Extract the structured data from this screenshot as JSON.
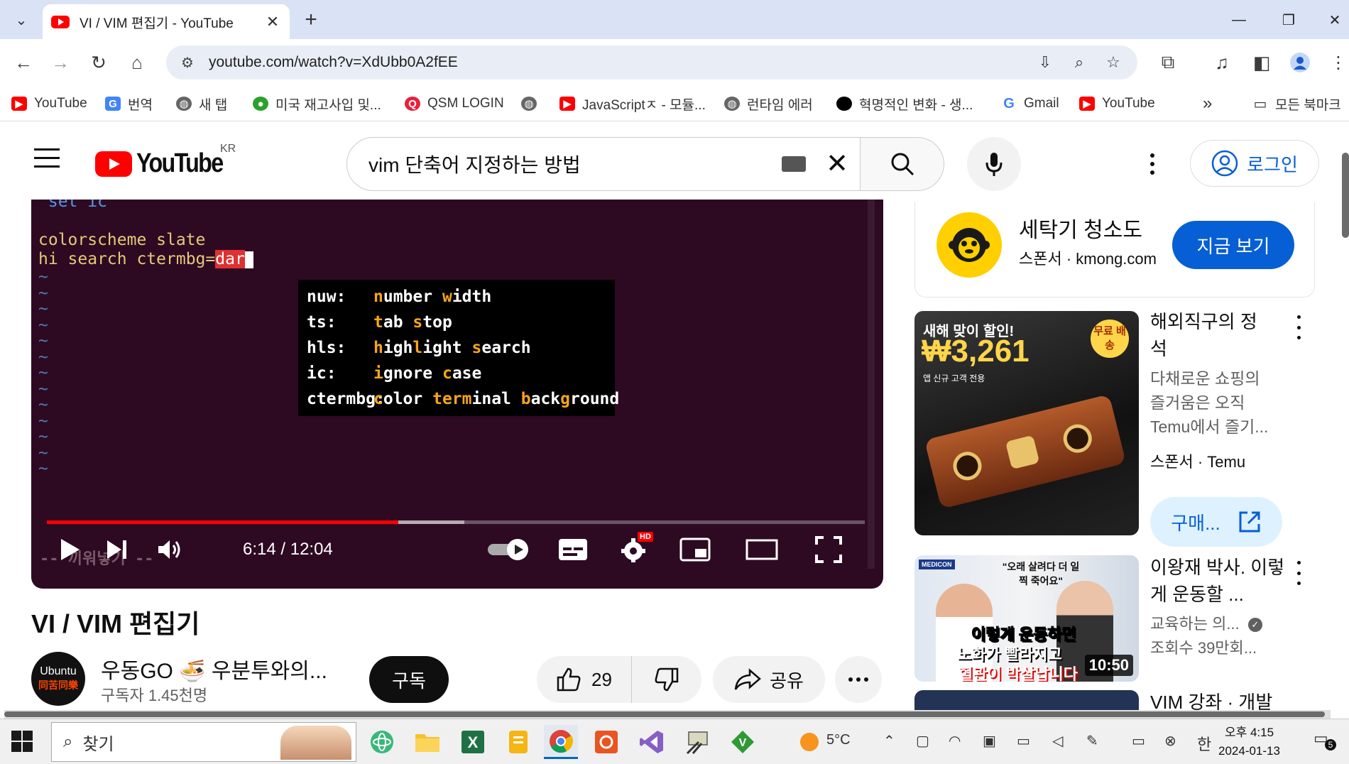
{
  "browser": {
    "tab": {
      "title": "VI / VIM 편집기 - YouTube",
      "close": "✕"
    },
    "new_tab": "+",
    "window_controls": {
      "minimize": "—",
      "maximize": "❐",
      "close": "✕"
    },
    "url": "youtube.com/watch?v=XdUbb0A2fEE",
    "bookmarks": [
      {
        "label": "YouTube",
        "icon": "youtube-icon",
        "color": "#ff0000"
      },
      {
        "label": "번역",
        "icon": "translate-icon",
        "color": "#4285f4"
      },
      {
        "label": "새 탭",
        "icon": "globe-icon",
        "color": "#555555"
      },
      {
        "label": "미국 재고사입 및...",
        "icon": "cup-icon",
        "color": "#2ca02c"
      },
      {
        "label": "QSM LOGIN",
        "icon": "qsm-icon",
        "color": "#e8213a"
      },
      {
        "label": "",
        "icon": "globe-icon",
        "color": "#555555"
      },
      {
        "label": "JavaScriptㅈ - 모듈...",
        "icon": "youtube-icon",
        "color": "#ff0000"
      },
      {
        "label": "런타임 에러",
        "icon": "globe-icon",
        "color": "#555555"
      },
      {
        "label": "혁명적인 변화 - 생...",
        "icon": "dot-icon",
        "color": "#000000"
      },
      {
        "label": "Gmail",
        "icon": "google-icon",
        "color": "#4285f4"
      },
      {
        "label": "YouTube",
        "icon": "youtube-icon",
        "color": "#ff0000"
      }
    ],
    "bookmarks_overflow": "»",
    "all_bookmarks": "모든 북마크"
  },
  "youtube": {
    "logo_text": "YouTube",
    "country": "KR",
    "search_query": "vim 단축어 지정하는 방법",
    "signin_label": "로그인"
  },
  "player": {
    "terminal_lines": [
      "\"set ic",
      "",
      "colorscheme slate",
      "hi search ctermbg="
    ],
    "cursor_text": "dar",
    "popup": [
      {
        "key": "nuw:",
        "parts": [
          [
            "n",
            "h"
          ],
          [
            "umber ",
            ""
          ],
          [
            "w",
            "h"
          ],
          [
            "idth",
            ""
          ]
        ]
      },
      {
        "key": "ts:",
        "parts": [
          [
            "t",
            "h"
          ],
          [
            "ab ",
            ""
          ],
          [
            "s",
            "h"
          ],
          [
            "top",
            ""
          ]
        ]
      },
      {
        "key": "hls:",
        "parts": [
          [
            "h",
            "h"
          ],
          [
            "igh",
            ""
          ],
          [
            "l",
            "h"
          ],
          [
            "ight ",
            ""
          ],
          [
            "s",
            "h"
          ],
          [
            "earch",
            ""
          ]
        ]
      },
      {
        "key": "ic:",
        "parts": [
          [
            "i",
            "h"
          ],
          [
            "gnore ",
            ""
          ],
          [
            "c",
            "h"
          ],
          [
            "ase",
            ""
          ]
        ]
      },
      {
        "key": "ctermbg:",
        "parts": [
          [
            "c",
            "h"
          ],
          [
            "olor ",
            ""
          ],
          [
            "term",
            "h"
          ],
          [
            "inal ",
            ""
          ],
          [
            "b",
            "h"
          ],
          [
            "ack",
            ""
          ],
          [
            "g",
            "h"
          ],
          [
            "round",
            ""
          ]
        ]
      }
    ],
    "time": "6:14 / 12:04",
    "progress_played": 0.43,
    "progress_buffered": 0.51,
    "hd_badge": "HD",
    "bottom_overlay": "-- 끼워넣기 --"
  },
  "video": {
    "title": "VI / VIM 편집기",
    "channel_name": "우동GO 🍜 우분투와의...",
    "channel_avatar_top": "Ubuntu",
    "channel_avatar_bottom": "同苦同樂",
    "subscribers": "구독자 1.45천명",
    "subscribe_label": "구독",
    "likes": "29",
    "share_label": "공유"
  },
  "sidebar": {
    "ad": {
      "title": "세탁기 청소도",
      "sponsor": "스폰서 · kmong.com",
      "cta": "지금 보기"
    },
    "items": [
      {
        "title": "해외직구의 정석",
        "desc": "다채로운 쇼핑의 즐거움은 오직 Temu에서 즐기...",
        "meta": "스폰서 · Temu",
        "thumb_text1": "새해 맞이 할인!",
        "thumb_price": "₩3,261",
        "thumb_text2": "앱 신규 고객 전용",
        "thumb_badge": "무료 배송",
        "buy_label": "구매..."
      },
      {
        "title": "이왕재 박사. 이렇게 운동할 ...",
        "channel": "교육하는 의...",
        "views": "조회수 39만회...",
        "duration": "10:50",
        "thumb_quote": "\"오래 살려다 더 일찍 죽어요\"",
        "thumb_line1": "이렇게 운동하면",
        "thumb_line2": "노화가 빨라지고",
        "thumb_line3": "혈관이 박살납니다",
        "thumb_logo": "MEDICON"
      },
      {
        "title": "VIM 강좌 · 개발"
      }
    ]
  },
  "taskbar": {
    "search_placeholder": "찾기",
    "weather": "5°C",
    "ime": "한",
    "time": "오후 4:15",
    "date": "2024-01-13",
    "notifications": "5"
  }
}
